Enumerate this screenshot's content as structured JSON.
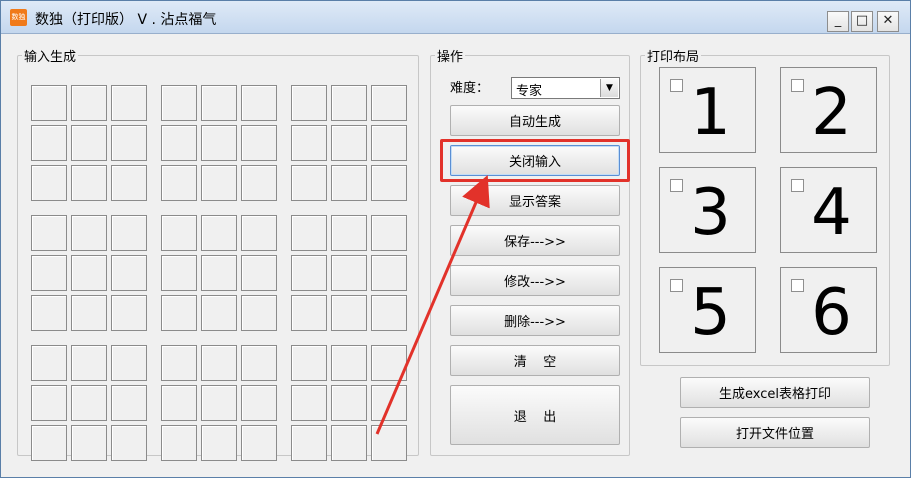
{
  "window": {
    "app_icon_text": "数独",
    "title": "数独（打印版） V . 沾点福气",
    "minimize_glyph": "_",
    "maximize_glyph": "□",
    "close_glyph": "✕"
  },
  "input_group": {
    "legend": "输入生成"
  },
  "operations": {
    "legend": "操作",
    "difficulty_label": "难度：",
    "difficulty_value": "专家",
    "buttons": {
      "auto_generate": "自动生成",
      "close_input": "关闭输入",
      "show_answer": "显示答案",
      "save": "保存--->>",
      "modify": "修改--->>",
      "delete": "删除--->>",
      "clear": "清    空",
      "exit": "退    出"
    }
  },
  "print_layout": {
    "legend": "打印布局",
    "slots": [
      "1",
      "2",
      "3",
      "4",
      "5",
      "6"
    ]
  },
  "bottom_buttons": {
    "generate_excel": "生成excel表格打印",
    "open_location": "打开文件位置"
  },
  "colors": {
    "annotation_red": "#e2322a"
  }
}
